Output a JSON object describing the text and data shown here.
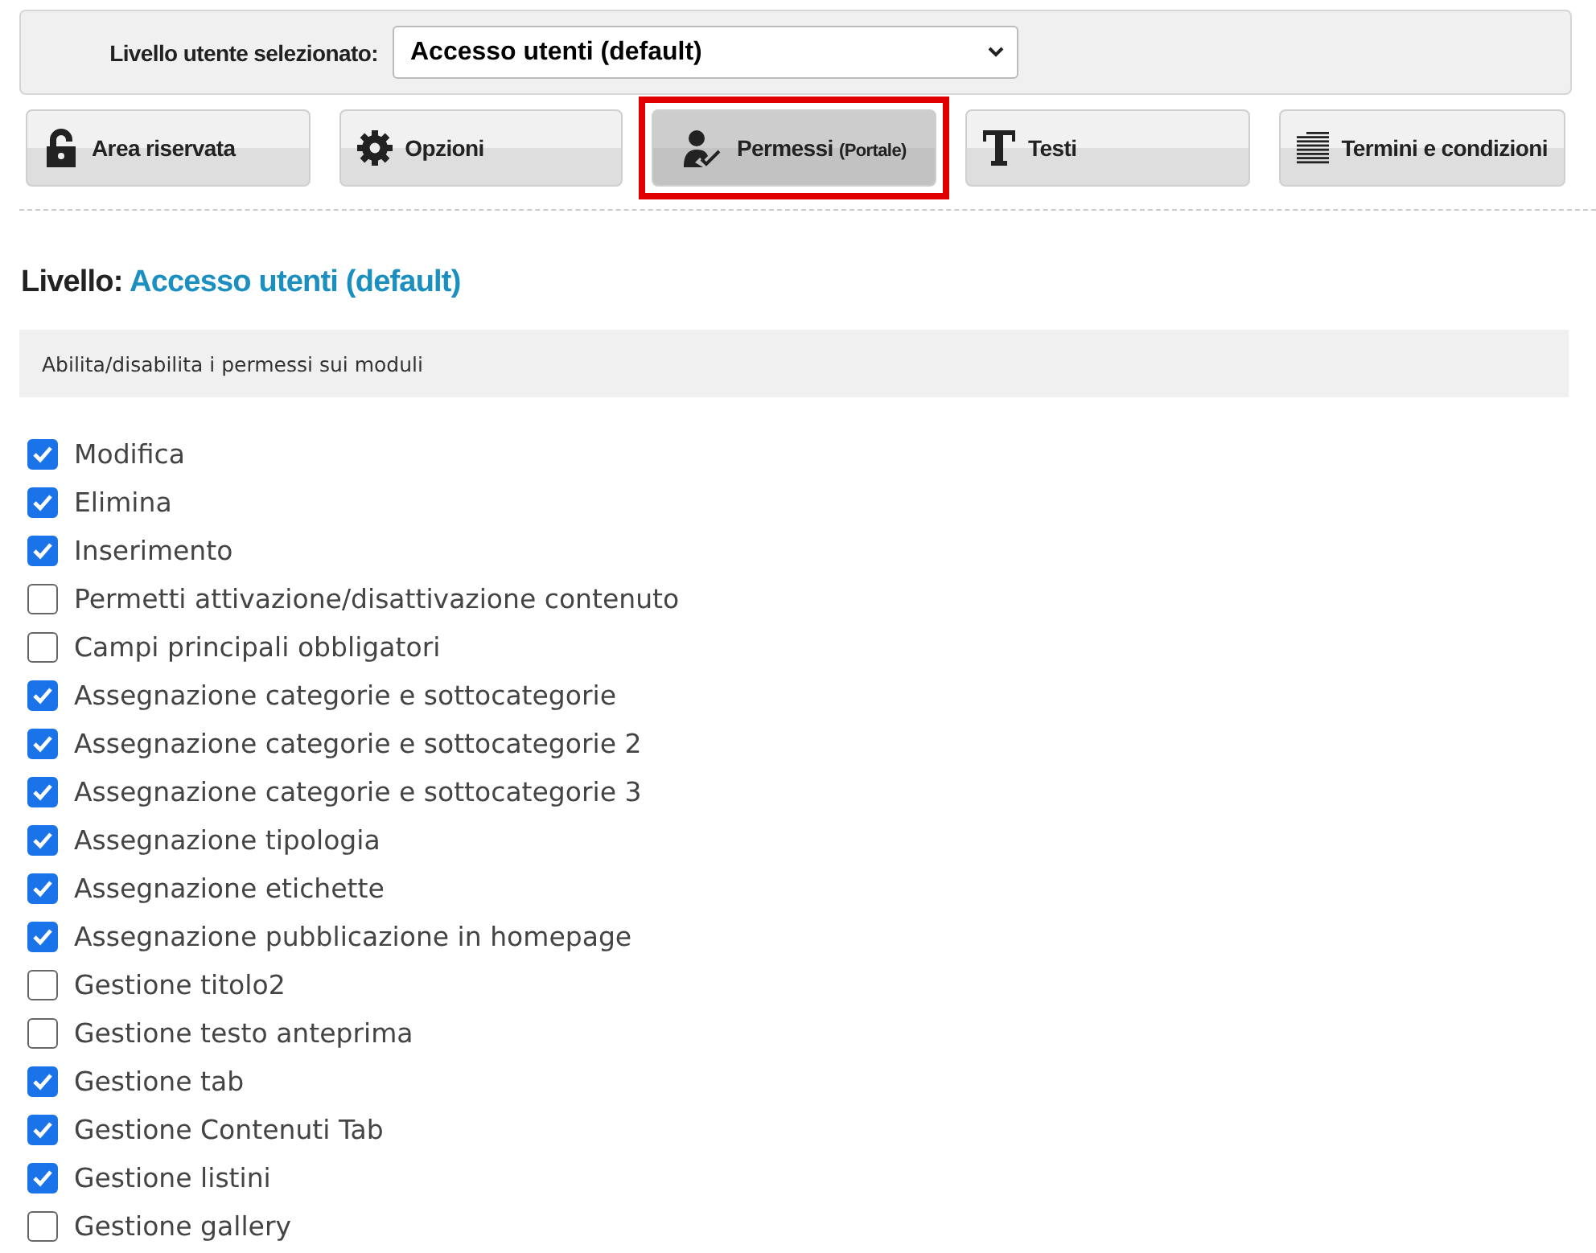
{
  "level_selector": {
    "label": "Livello utente selezionato:",
    "value": "Accesso utenti (default)"
  },
  "tabs": [
    {
      "kind": "lock",
      "label": "Area riservata",
      "selected": false
    },
    {
      "kind": "gear",
      "label": "Opzioni",
      "selected": false
    },
    {
      "kind": "user",
      "label": "Permessi",
      "sublabel": "(Portale)",
      "selected": true
    },
    {
      "kind": "text",
      "label": "Testi",
      "selected": false
    },
    {
      "kind": "lines",
      "label": "Termini e condizioni",
      "selected": false
    }
  ],
  "heading": {
    "prefix": "Livello:",
    "value": "Accesso utenti (default)"
  },
  "info_box": "Abilita/disabilita i permessi sui moduli",
  "permissions": [
    {
      "label": "Modifica",
      "checked": true
    },
    {
      "label": "Elimina",
      "checked": true
    },
    {
      "label": "Inserimento",
      "checked": true
    },
    {
      "label": "Permetti attivazione/disattivazione contenuto",
      "checked": false
    },
    {
      "label": "Campi principali obbligatori",
      "checked": false
    },
    {
      "label": "Assegnazione categorie e sottocategorie",
      "checked": true
    },
    {
      "label": "Assegnazione categorie e sottocategorie 2",
      "checked": true
    },
    {
      "label": "Assegnazione categorie e sottocategorie 3",
      "checked": true
    },
    {
      "label": "Assegnazione tipologia",
      "checked": true
    },
    {
      "label": "Assegnazione etichette",
      "checked": true
    },
    {
      "label": "Assegnazione pubblicazione in homepage",
      "checked": true
    },
    {
      "label": "Gestione titolo2",
      "checked": false
    },
    {
      "label": "Gestione testo anteprima",
      "checked": false
    },
    {
      "label": "Gestione tab",
      "checked": true
    },
    {
      "label": "Gestione Contenuti Tab",
      "checked": true
    },
    {
      "label": "Gestione listini",
      "checked": true
    },
    {
      "label": "Gestione gallery",
      "checked": false
    }
  ]
}
